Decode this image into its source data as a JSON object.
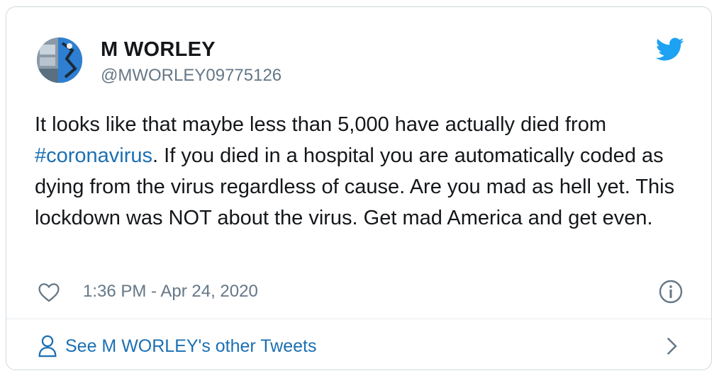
{
  "tweet": {
    "author": {
      "display_name": "M WORLEY",
      "handle": "@MWORLEY09775126",
      "avatar_icon": "avatar-photo"
    },
    "brand_icon": "twitter-bird-icon",
    "text_before_hashtag": "It looks like that maybe less than 5,000 have actually died from ",
    "hashtag": "#coronavirus",
    "text_after_hashtag": ". If you died in a hospital you are automatically coded as dying from the virus regardless of cause. Are you mad as hell yet. This lockdown was NOT about the virus. Get mad America and get even.",
    "timestamp": "1:36 PM - Apr 24, 2020",
    "like_icon": "heart-icon",
    "info_icon": "info-icon"
  },
  "footer": {
    "label": "See M WORLEY's other Tweets",
    "icon": "person-icon",
    "chevron_icon": "chevron-right-icon"
  },
  "colors": {
    "link": "#1b6fb2",
    "twitter_blue": "#1da1f2",
    "secondary_text": "#657786",
    "primary_text": "#14171a",
    "border": "#cfd9de"
  }
}
